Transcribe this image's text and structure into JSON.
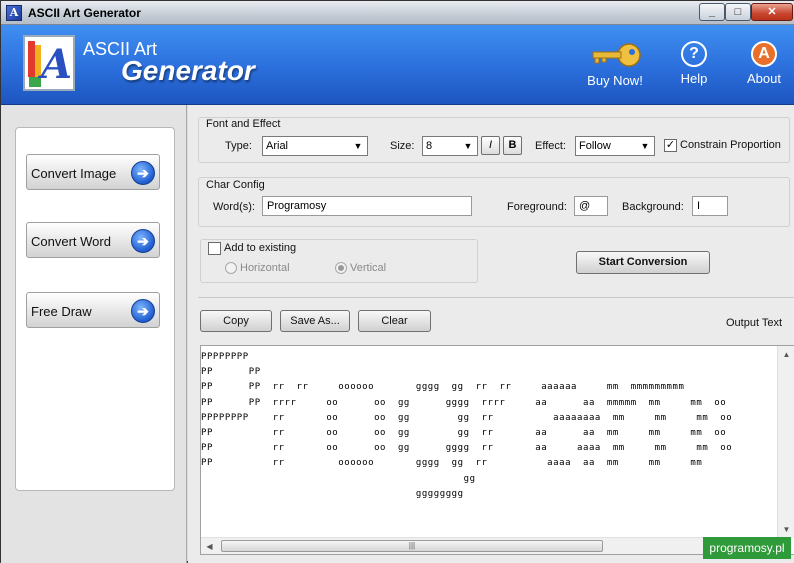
{
  "window": {
    "title": "ASCII Art Generator",
    "app_icon_text": "A"
  },
  "banner": {
    "brand_line1": "ASCII Art",
    "brand_line2": "Generator",
    "buy_label": "Buy Now!",
    "help_label": "Help",
    "help_glyph": "?",
    "about_label": "About",
    "about_glyph": "A"
  },
  "nav": [
    {
      "label": "Convert Image"
    },
    {
      "label": "Convert Word"
    },
    {
      "label": "Free Draw"
    }
  ],
  "font_effect": {
    "group_label": "Font and Effect",
    "type_label": "Type:",
    "type_value": "Arial",
    "size_label": "Size:",
    "size_value": "8",
    "italic_label": "I",
    "bold_label": "B",
    "effect_label": "Effect:",
    "effect_value": "Follow",
    "constrain_label": "Constrain Proportion",
    "constrain_checked": "✓"
  },
  "char_config": {
    "group_label": "Char Config",
    "words_label": "Word(s):",
    "words_value": "Programosy",
    "fg_label": "Foreground:",
    "fg_value": "@",
    "bg_label": "Background:",
    "bg_value": "I"
  },
  "add_existing": {
    "label": "Add to existing",
    "horizontal_label": "Horizontal",
    "vertical_label": "Vertical"
  },
  "actions": {
    "start_label": "Start Conversion",
    "copy_label": "Copy",
    "saveas_label": "Save As...",
    "clear_label": "Clear",
    "output_label": "Output Text"
  },
  "output_lines": [
    "PPPPPPPP",
    "PP      PP",
    "PP      PP  rr  rr     oooooo       gggg  gg  rr  rr     aaaaaa     mm  mmmmmmmmm",
    "PP      PP  rrrr     oo      oo  gg      gggg  rrrr     aa      aa  mmmmm  mm     mm  oo",
    "PPPPPPPP    rr       oo      oo  gg        gg  rr          aaaaaaaa  mm     mm     mm  oo",
    "PP          rr       oo      oo  gg        gg  rr       aa      aa  mm     mm     mm  oo",
    "PP          rr       oo      oo  gg      gggg  rr       aa     aaaa  mm     mm     mm  oo",
    "PP          rr         oooooo       gggg  gg  rr          aaaa  aa  mm     mm     mm",
    "                                            gg",
    "                                    gggggggg"
  ],
  "watermark": "programosy.pl",
  "colors": {
    "banner": "#2b6fdc",
    "watermark": "#2f9a3a"
  }
}
